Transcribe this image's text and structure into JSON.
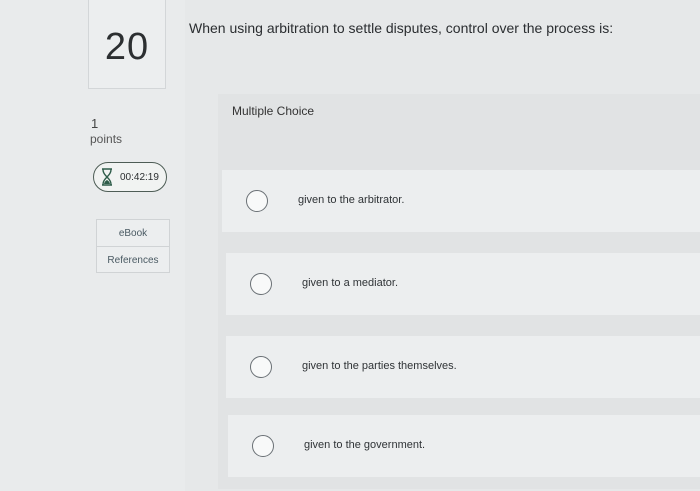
{
  "question": {
    "number": "20",
    "text": "When using arbitration to settle disputes, control over the process is:",
    "points_value": "1",
    "points_label": "points",
    "type_label": "Multiple Choice"
  },
  "timer": {
    "time": "00:42:19",
    "icon": "hourglass-icon"
  },
  "resources": {
    "ebook_label": "eBook",
    "references_label": "References"
  },
  "choices": [
    {
      "label": "given to the arbitrator."
    },
    {
      "label": "given to a mediator."
    },
    {
      "label": "given to the parties themselves."
    },
    {
      "label": "given to the government."
    }
  ]
}
